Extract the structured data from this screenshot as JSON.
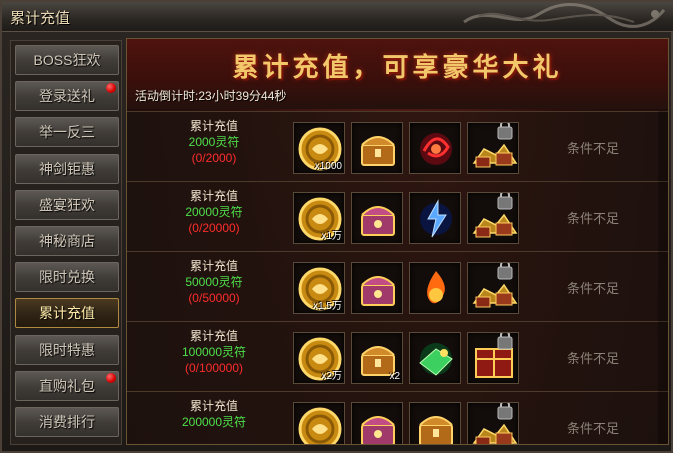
{
  "window": {
    "title": "累计充值"
  },
  "sidebar": {
    "items": [
      {
        "label": "BOSS狂欢",
        "dot": false,
        "active": false
      },
      {
        "label": "登录送礼",
        "dot": true,
        "active": false
      },
      {
        "label": "举一反三",
        "dot": false,
        "active": false
      },
      {
        "label": "神剑钜惠",
        "dot": false,
        "active": false
      },
      {
        "label": "盛宴狂欢",
        "dot": false,
        "active": false
      },
      {
        "label": "神秘商店",
        "dot": false,
        "active": false
      },
      {
        "label": "限时兑换",
        "dot": false,
        "active": false
      },
      {
        "label": "累计充值",
        "dot": false,
        "active": true
      },
      {
        "label": "限时特惠",
        "dot": false,
        "active": false
      },
      {
        "label": "直购礼包",
        "dot": true,
        "active": false
      },
      {
        "label": "消费排行",
        "dot": false,
        "active": false
      }
    ]
  },
  "banner": {
    "title": "累计充值，可享豪华大礼",
    "countdown": "活动倒计时:23小时39分44秒"
  },
  "rows": [
    {
      "label": "累计充值",
      "amount": "2000灵符",
      "progress": "(0/2000)",
      "status": "条件不足",
      "items": [
        {
          "icon": "gold-coin-icon",
          "qty": "x1000"
        },
        {
          "icon": "treasure-chest-icon",
          "qty": ""
        },
        {
          "icon": "red-swirl-orb-icon",
          "qty": ""
        },
        {
          "icon": "locked-treasure-chest-icon",
          "qty": ""
        }
      ]
    },
    {
      "label": "累计充值",
      "amount": "20000灵符",
      "progress": "(0/20000)",
      "status": "条件不足",
      "items": [
        {
          "icon": "gold-coin-icon",
          "qty": "x1万"
        },
        {
          "icon": "gem-chest-icon",
          "qty": ""
        },
        {
          "icon": "blue-lightning-icon",
          "qty": ""
        },
        {
          "icon": "treasure-pile-icon",
          "qty": ""
        }
      ]
    },
    {
      "label": "累计充值",
      "amount": "50000灵符",
      "progress": "(0/50000)",
      "status": "条件不足",
      "items": [
        {
          "icon": "gold-coin-icon",
          "qty": "x1.5万"
        },
        {
          "icon": "gem-chest-icon",
          "qty": ""
        },
        {
          "icon": "flame-emblem-icon",
          "qty": ""
        },
        {
          "icon": "treasure-pile-icon",
          "qty": ""
        }
      ]
    },
    {
      "label": "累计充值",
      "amount": "100000灵符",
      "progress": "(0/100000)",
      "status": "条件不足",
      "items": [
        {
          "icon": "gold-coin-icon",
          "qty": "x2万"
        },
        {
          "icon": "treasure-chest-icon",
          "qty": "x2"
        },
        {
          "icon": "green-gem-flare-icon",
          "qty": ""
        },
        {
          "icon": "red-treasure-box-icon",
          "qty": ""
        }
      ]
    },
    {
      "label": "累计充值",
      "amount": "200000灵符",
      "progress": "",
      "status": "条件不足",
      "items": [
        {
          "icon": "gold-coin-icon",
          "qty": ""
        },
        {
          "icon": "gem-chest-icon",
          "qty": ""
        },
        {
          "icon": "gold-chest-icon",
          "qty": ""
        },
        {
          "icon": "treasure-pile-icon",
          "qty": ""
        }
      ]
    }
  ],
  "colors": {
    "amount": "#4ee04a",
    "progress": "#ff2c2c",
    "status": "#8a8178",
    "banner_title": "#f3c86b"
  }
}
